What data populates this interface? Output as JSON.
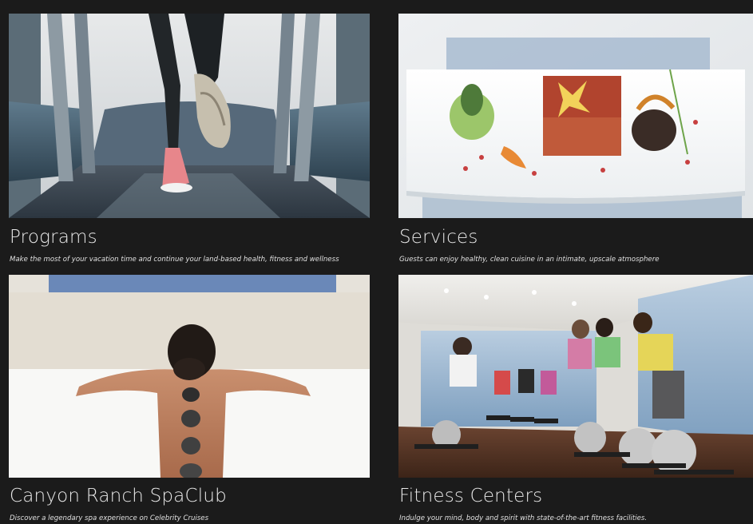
{
  "cards": [
    {
      "title": "Programs",
      "description": "Make the most of your vacation time and continue your land-based health, fitness and wellness",
      "image": "treadmill-runner-photo"
    },
    {
      "title": "Services",
      "description": "Guests can enjoy healthy, clean cuisine in an intimate, upscale atmosphere",
      "image": "plated-cuisine-photo"
    },
    {
      "title": "Canyon Ranch SpaClub",
      "description": "Discover a legendary spa experience on Celebrity Cruises",
      "image": "hot-stone-massage-photo"
    },
    {
      "title": "Fitness Centers",
      "description": "Indulge your mind, body and spirit with state-of-the-art fitness facilities.",
      "image": "spin-class-photo"
    }
  ],
  "colors": {
    "background": "#1b1b1b",
    "title_text": "#e8e8e8",
    "description_text": "#e0e0e0"
  }
}
